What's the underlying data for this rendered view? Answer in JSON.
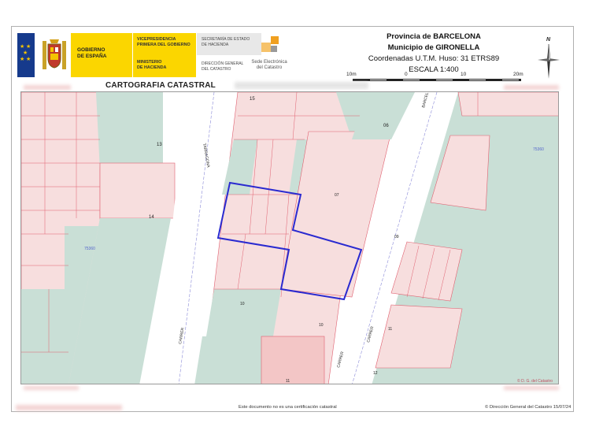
{
  "header": {
    "gov_name": "GOBIERNO\nDE ESPAÑA",
    "vice": "VICEPRESIDENCIA\nPRIMERA DEL GOBIERNO",
    "ministry": "MINISTERIO\nDE HACIENDA",
    "secretary": "SECRETARÍA DE ESTADO\nDE HACIENDA",
    "directorate": "DIRECCIÓN GENERAL\nDEL CATASTRO",
    "sede": "Sede Electrónica\ndel Catastro"
  },
  "location": {
    "province": "Provincia de BARCELONA",
    "municipality": "Municipio de GIRONELLA",
    "coordinates": "Coordenadas U.T.M. Huso: 31 ETRS89",
    "scale": "ESCALA 1:400"
  },
  "scalebar": {
    "labels": [
      "10m",
      "0",
      "10",
      "20m"
    ]
  },
  "north_label": "N",
  "map_title": "CARTOGRAFIA CATASTRAL",
  "map": {
    "streets": [
      "TARRAGONA",
      "CARRER",
      "CARRER",
      "CARRER",
      "BARCEL"
    ],
    "parcel_numbers": [
      "13",
      "14",
      "15",
      "06",
      "07",
      "09",
      "10",
      "10",
      "11",
      "11",
      "12"
    ],
    "zones": [
      "75360",
      "75360"
    ],
    "watermark": "© D. G. del Catastro"
  },
  "footer": {
    "disclaimer": "Este documento no es una certificación catastral",
    "copyright": "© Dirección General del Catastro 15/07/24"
  },
  "colors": {
    "parcel_fill": "#f7dede",
    "green_fill": "#c9dfd6",
    "boundary": "#e06070",
    "highlight": "#2a2ad0",
    "street": "#ffffff"
  }
}
